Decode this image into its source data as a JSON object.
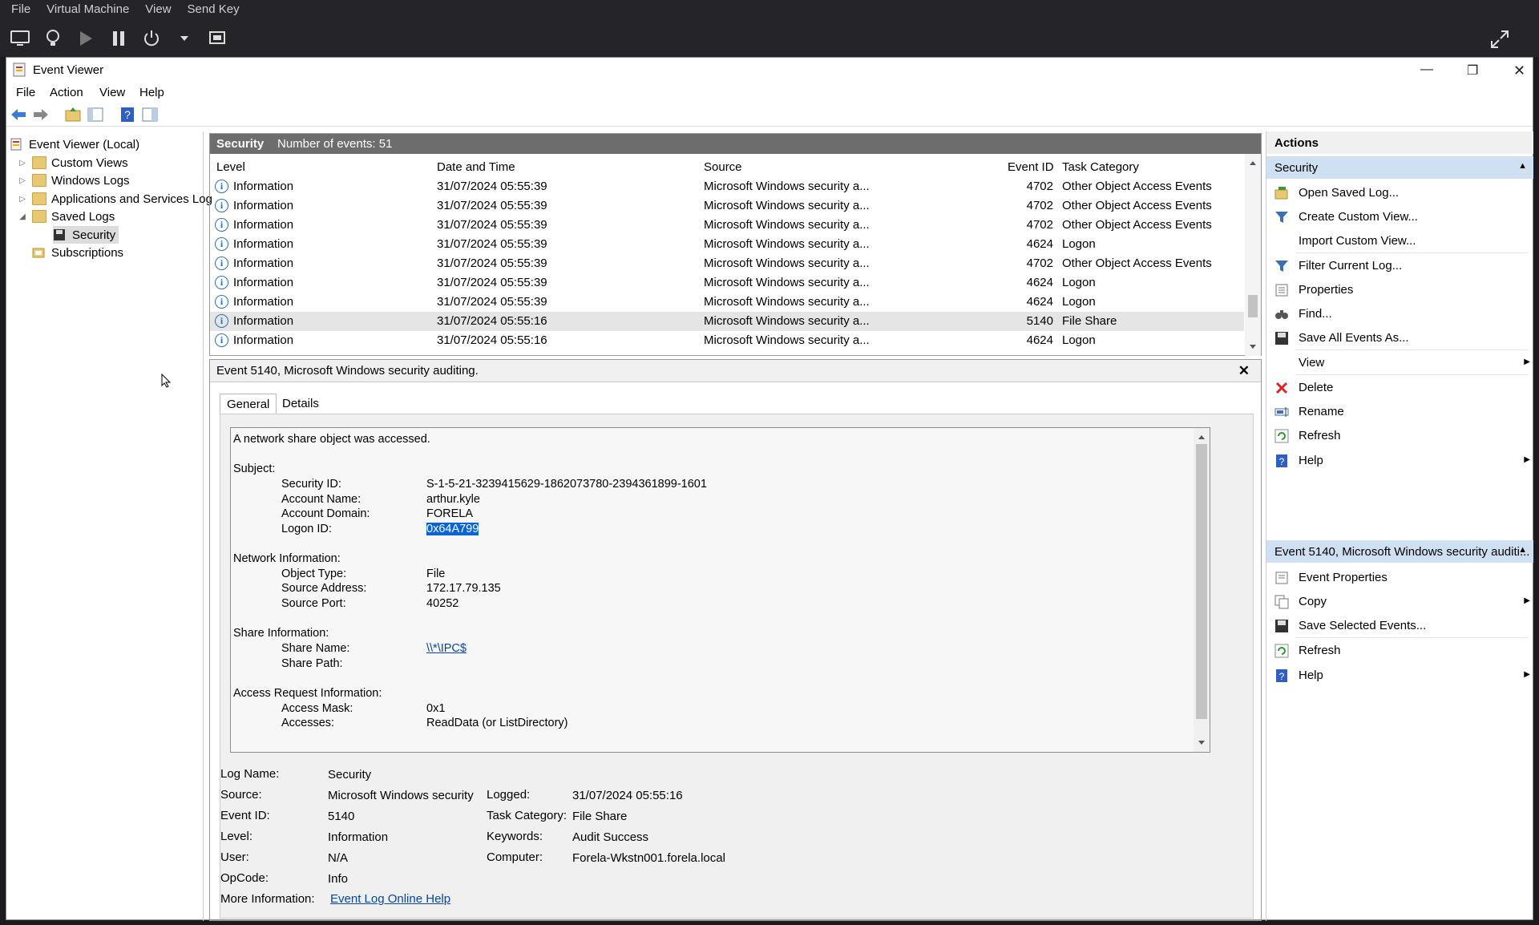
{
  "vm": {
    "menu": [
      "File",
      "Virtual Machine",
      "View",
      "Send Key"
    ]
  },
  "window": {
    "title": "Event Viewer",
    "menu": [
      "File",
      "Action",
      "View",
      "Help"
    ]
  },
  "tree": {
    "root": "Event Viewer (Local)",
    "custom_views": "Custom Views",
    "windows_logs": "Windows Logs",
    "app_services": "Applications and Services Log",
    "saved_logs": "Saved Logs",
    "security": "Security",
    "subscriptions": "Subscriptions"
  },
  "list": {
    "log_name": "Security",
    "count_label": "Number of events: 51",
    "columns": [
      "Level",
      "Date and Time",
      "Source",
      "Event ID",
      "Task Category"
    ],
    "rows": [
      {
        "level": "Information",
        "date": "31/07/2024 05:55:39",
        "source": "Microsoft Windows security a...",
        "id": "4702",
        "category": "Other Object Access Events"
      },
      {
        "level": "Information",
        "date": "31/07/2024 05:55:39",
        "source": "Microsoft Windows security a...",
        "id": "4702",
        "category": "Other Object Access Events"
      },
      {
        "level": "Information",
        "date": "31/07/2024 05:55:39",
        "source": "Microsoft Windows security a...",
        "id": "4702",
        "category": "Other Object Access Events"
      },
      {
        "level": "Information",
        "date": "31/07/2024 05:55:39",
        "source": "Microsoft Windows security a...",
        "id": "4624",
        "category": "Logon"
      },
      {
        "level": "Information",
        "date": "31/07/2024 05:55:39",
        "source": "Microsoft Windows security a...",
        "id": "4702",
        "category": "Other Object Access Events"
      },
      {
        "level": "Information",
        "date": "31/07/2024 05:55:39",
        "source": "Microsoft Windows security a...",
        "id": "4624",
        "category": "Logon"
      },
      {
        "level": "Information",
        "date": "31/07/2024 05:55:39",
        "source": "Microsoft Windows security a...",
        "id": "4624",
        "category": "Logon"
      },
      {
        "level": "Information",
        "date": "31/07/2024 05:55:16",
        "source": "Microsoft Windows security a...",
        "id": "5140",
        "category": "File Share"
      },
      {
        "level": "Information",
        "date": "31/07/2024 05:55:16",
        "source": "Microsoft Windows security a...",
        "id": "4624",
        "category": "Logon"
      }
    ]
  },
  "detail": {
    "header": "Event 5140, Microsoft Windows security auditing.",
    "tabs": [
      "General",
      "Details"
    ],
    "message": {
      "intro": "A network share object was accessed.",
      "subject": "Subject:",
      "security_id_label": "Security ID:",
      "security_id": "S-1-5-21-3239415629-1862073780-2394361899-1601",
      "account_name_label": "Account Name:",
      "account_name": "arthur.kyle",
      "account_domain_label": "Account Domain:",
      "account_domain": "FORELA",
      "logon_id_label": "Logon ID:",
      "logon_id": "0x64A799",
      "network": "Network Information:",
      "object_type_label": "Object Type:",
      "object_type": "File",
      "source_address_label": "Source Address:",
      "source_address": "172.17.79.135",
      "source_port_label": "Source Port:",
      "source_port": "40252",
      "share": "Share Information:",
      "share_name_label": "Share Name:",
      "share_name": "\\\\*\\IPC$",
      "share_path_label": "Share Path:",
      "access": "Access Request Information:",
      "access_mask_label": "Access Mask:",
      "access_mask": "0x1",
      "accesses_label": "Accesses:",
      "accesses": "ReadData (or ListDirectory)"
    },
    "props": {
      "log_name_label": "Log Name:",
      "log_name": "Security",
      "source_label": "Source:",
      "source": "Microsoft Windows security a",
      "logged_label": "Logged:",
      "logged": "31/07/2024 05:55:16",
      "event_id_label": "Event ID:",
      "event_id": "5140",
      "task_label": "Task Category:",
      "task": "File Share",
      "level_label": "Level:",
      "level": "Information",
      "keywords_label": "Keywords:",
      "keywords": "Audit Success",
      "user_label": "User:",
      "user": "N/A",
      "computer_label": "Computer:",
      "computer": "Forela-Wkstn001.forela.local",
      "opcode_label": "OpCode:",
      "opcode": "Info",
      "more_label": "More Information:",
      "more_link": "Event Log Online Help"
    }
  },
  "actions": {
    "title": "Actions",
    "section1": "Security",
    "items1": [
      "Open Saved Log...",
      "Create Custom View...",
      "Import Custom View...",
      "Filter Current Log...",
      "Properties",
      "Find...",
      "Save All Events As...",
      "View",
      "Delete",
      "Rename",
      "Refresh",
      "Help"
    ],
    "section2": "Event 5140, Microsoft Windows security auditi...",
    "items2": [
      "Event Properties",
      "Copy",
      "Save Selected Events...",
      "Refresh",
      "Help"
    ]
  },
  "colors": {
    "accent": "#0a64d6",
    "section": "#cfe0f3",
    "list_header": "#6d6d6d"
  }
}
